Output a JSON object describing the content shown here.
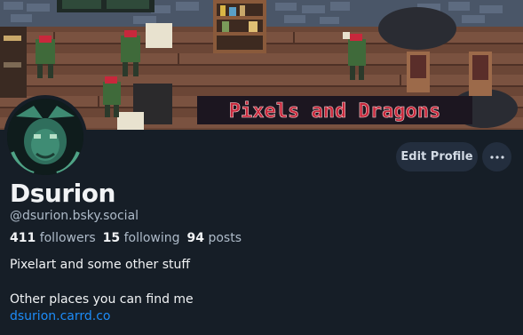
{
  "banner": {
    "sign_text": "Pixels and Dragons"
  },
  "actions": {
    "edit_profile_label": "Edit Profile",
    "more_label": "···"
  },
  "profile": {
    "display_name": "Dsurion",
    "handle": "@dsurion.bsky.social",
    "followers_count": "411",
    "followers_label": "followers",
    "following_count": "15",
    "following_label": "following",
    "posts_count": "94",
    "posts_label": "posts",
    "bio_line1": "Pixelart and some other stuff",
    "bio_line2": "Other places you can find me",
    "link_text": "dsurion.carrd.co"
  },
  "colors": {
    "background": "#161e27",
    "button_bg": "#232e3e",
    "link": "#1d8cf8",
    "muted_text": "#aebbc9",
    "sign_red": "#c8283c"
  }
}
